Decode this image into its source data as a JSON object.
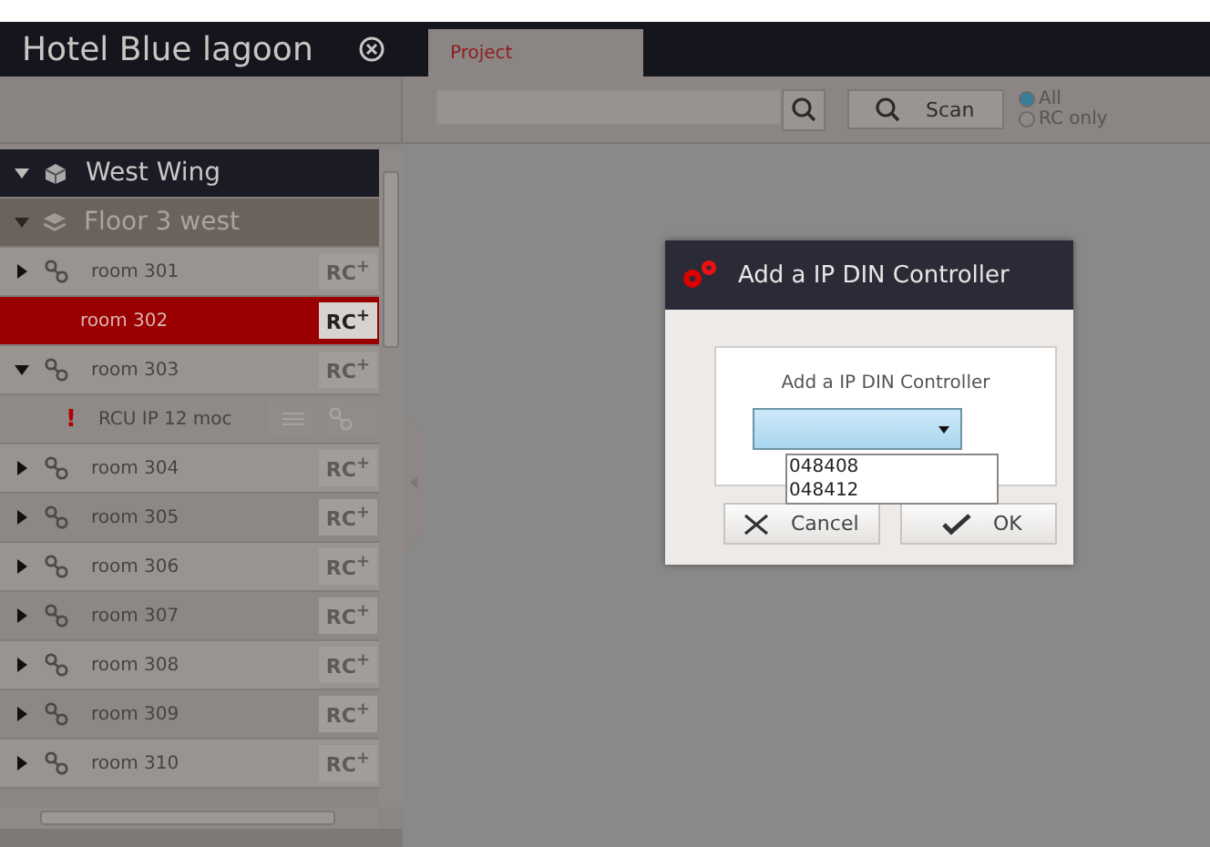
{
  "sidebar": {
    "title": "Hotel Blue lagoon",
    "tree": [
      {
        "label": "West Wing",
        "kind": "wing",
        "expanded": true,
        "children": [
          {
            "label": "Floor 3 west",
            "kind": "floor",
            "expanded": true,
            "children": [
              {
                "label": "room 301",
                "kind": "room",
                "expanded": false,
                "selected": false,
                "button": "RC$^{+}$"
              },
              {
                "label": "room 302",
                "kind": "room",
                "selected": true,
                "button": "RC$^{+}$"
              },
              {
                "label": "room 303",
                "kind": "room",
                "expanded": true,
                "selected": false,
                "button": "RC$^{+}$",
                "children": [
                  {
                    "label": "RCU IP 12 moc",
                    "kind": "device",
                    "warning": "!"
                  }
                ]
              },
              {
                "label": "room 304",
                "kind": "room",
                "expanded": false,
                "selected": false,
                "button": "RC$^{+}$"
              },
              {
                "label": "room 305",
                "kind": "room",
                "expanded": false,
                "selected": false,
                "button": "RC$^{+}$"
              },
              {
                "label": "room 306",
                "kind": "room",
                "expanded": false,
                "selected": false,
                "button": "RC$^{+}$"
              },
              {
                "label": "room 307",
                "kind": "room",
                "expanded": false,
                "selected": false,
                "button": "RC$^{+}$"
              },
              {
                "label": "room 308",
                "kind": "room",
                "expanded": false,
                "selected": false,
                "button": "RC$^{+}$"
              },
              {
                "label": "room 309",
                "kind": "room",
                "expanded": false,
                "selected": false,
                "button": "RC$^{+}$"
              },
              {
                "label": "room 310",
                "kind": "room",
                "expanded": false,
                "selected": false,
                "button": "RC$^{+}$"
              }
            ]
          }
        ]
      }
    ]
  },
  "tabs": [
    {
      "label": "Project",
      "selected": true
    }
  ],
  "toolbar": {
    "scan": "Scan",
    "filters": [
      {
        "label": "All",
        "selected": true
      },
      {
        "label": "RC only",
        "selected": false
      }
    ]
  },
  "dialog": {
    "title": "Add a IP DIN Controller",
    "prompt": "Add a IP DIN Controller",
    "options": [
      "048408",
      "048412"
    ],
    "buttons": [
      {
        "label": "Cancel",
        "kind": "cancel"
      },
      {
        "label": "OK",
        "kind": "ok"
      }
    ]
  }
}
